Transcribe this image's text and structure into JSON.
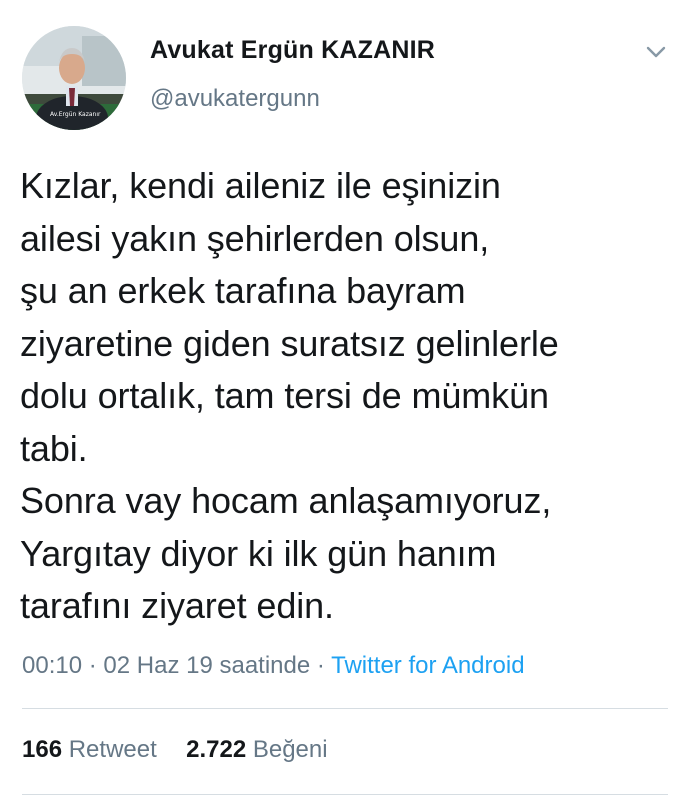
{
  "author": {
    "display_name": "Avukat Ergün KAZANIR",
    "handle": "@avukatergunn",
    "avatar_caption": "Av.Ergün Kazanır"
  },
  "tweet": {
    "text": "Kızlar, kendi aileniz ile eşinizin\nailesi yakın şehirlerden olsun,\nşu an erkek tarafına bayram\nziyaretine giden suratsız gelinlerle\ndolu ortalık, tam tersi de mümkün\ntabi.\nSonra vay hocam anlaşamıyoruz,\nYargıtay diyor ki ilk gün hanım\ntarafını ziyaret edin.",
    "time": "00:10",
    "separator": "·",
    "date": "02 Haz 19 saatinde",
    "source": "Twitter for Android"
  },
  "stats": {
    "retweet_count": "166",
    "retweet_label": "Retweet",
    "like_count": "2.722",
    "like_label": "Beğeni"
  },
  "icons": {
    "menu": "chevron-down-icon"
  },
  "colors": {
    "text_primary": "#14171a",
    "text_secondary": "#657786",
    "link": "#1da1f2",
    "divider": "#d6dde2"
  }
}
